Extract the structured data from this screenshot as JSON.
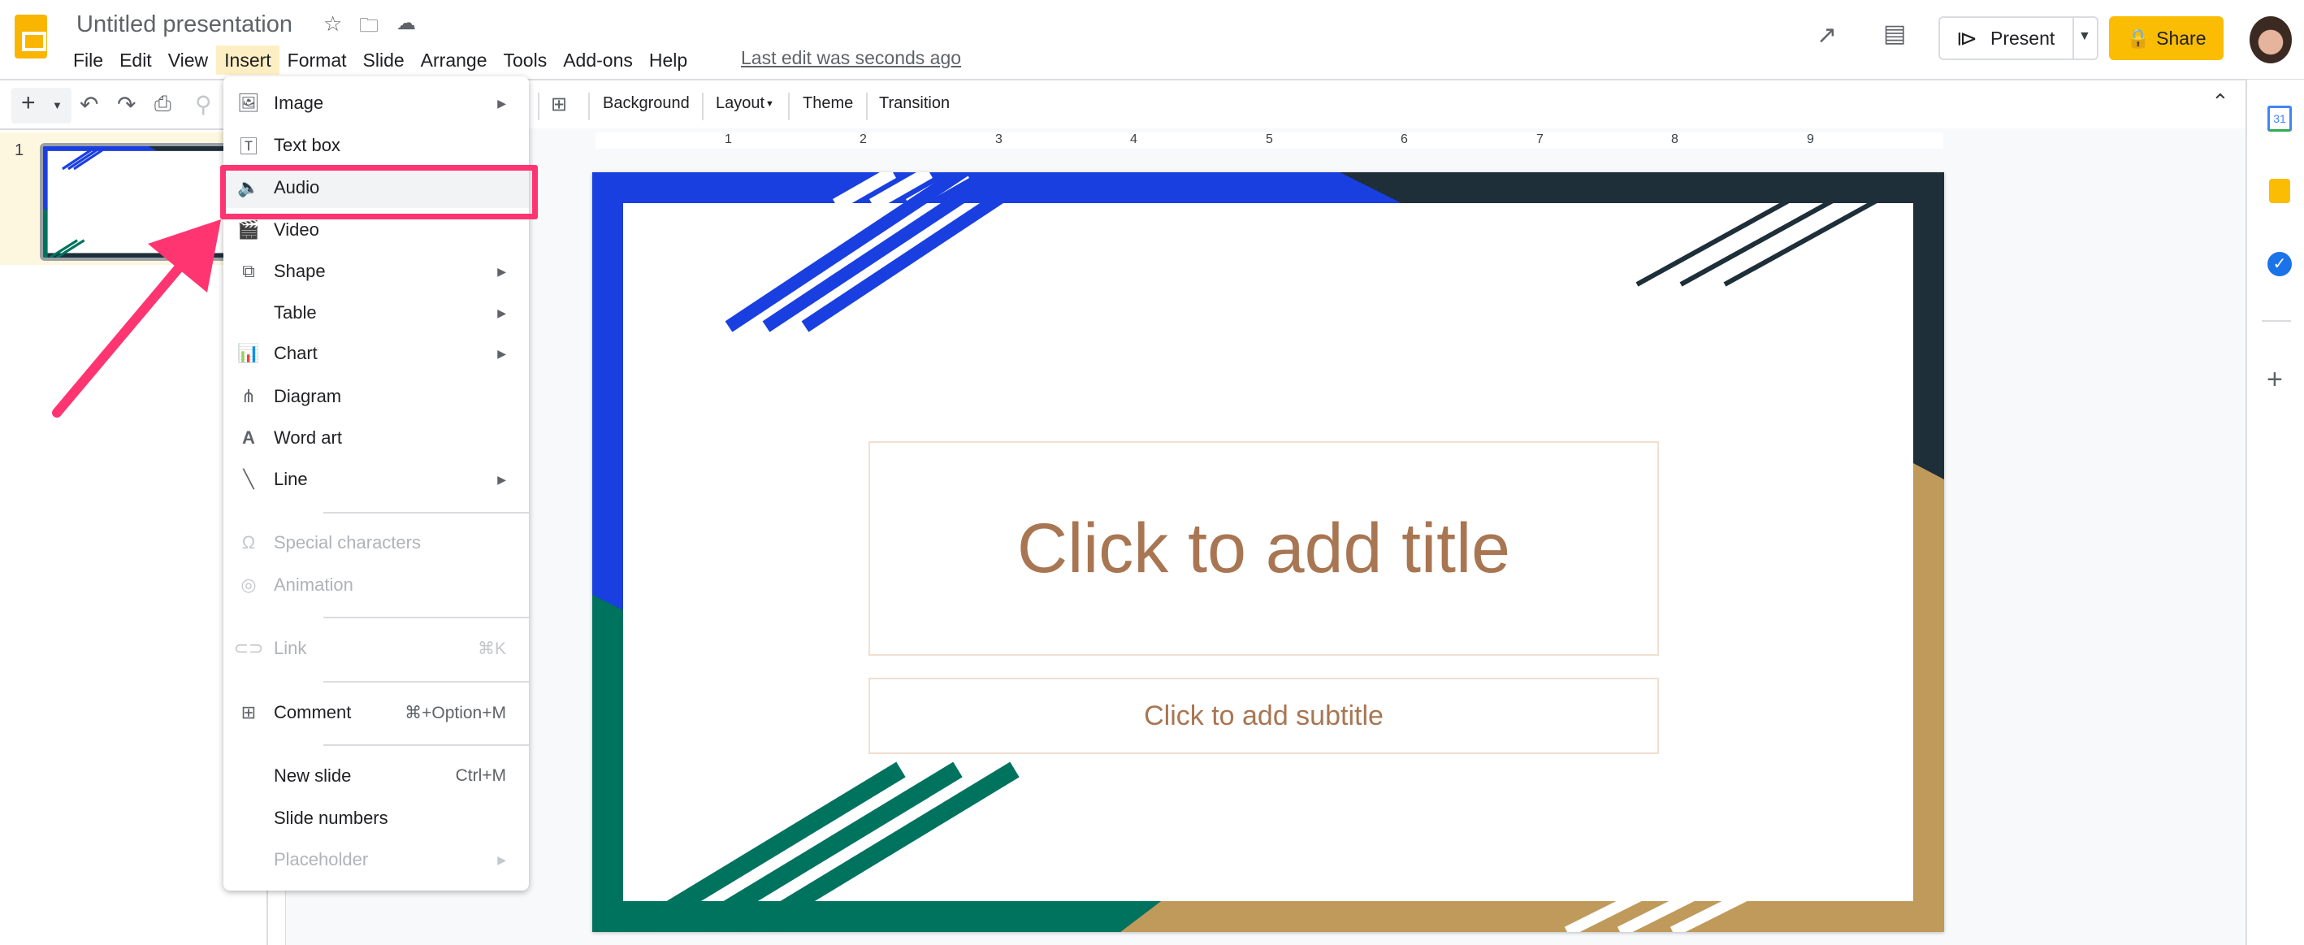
{
  "header": {
    "title": "Untitled presentation",
    "last_edit": "Last edit was seconds ago",
    "present_label": "Present",
    "share_label": "Share",
    "menus": [
      "File",
      "Edit",
      "View",
      "Insert",
      "Format",
      "Slide",
      "Arrange",
      "Tools",
      "Add-ons",
      "Help"
    ],
    "active_menu": "Insert"
  },
  "toolbar": {
    "background": "Background",
    "layout": "Layout",
    "theme": "Theme",
    "transition": "Transition"
  },
  "ruler": [
    "1",
    "2",
    "3",
    "4",
    "5",
    "6",
    "7",
    "8",
    "9"
  ],
  "filmstrip": {
    "slide_number": "1"
  },
  "slide": {
    "title_placeholder": "Click to add title",
    "subtitle_placeholder": "Click to add subtitle"
  },
  "insert_menu": {
    "items": [
      {
        "label": "Image",
        "icon": "image-icon",
        "submenu": true
      },
      {
        "label": "Text box",
        "icon": "text-box-icon"
      },
      {
        "label": "Audio",
        "icon": "audio-icon",
        "highlighted": true
      },
      {
        "label": "Video",
        "icon": "video-icon"
      },
      {
        "label": "Shape",
        "icon": "shape-icon",
        "submenu": true
      },
      {
        "label": "Table",
        "submenu": true
      },
      {
        "label": "Chart",
        "icon": "chart-icon",
        "submenu": true
      },
      {
        "label": "Diagram",
        "icon": "diagram-icon"
      },
      {
        "label": "Word art",
        "icon": "word-art-icon"
      },
      {
        "label": "Line",
        "icon": "line-icon",
        "submenu": true
      },
      {
        "label": "Special characters",
        "icon": "omega-icon",
        "disabled": true
      },
      {
        "label": "Animation",
        "icon": "animation-icon",
        "disabled": true
      },
      {
        "label": "Link",
        "icon": "link-icon",
        "disabled": true,
        "shortcut": "⌘K"
      },
      {
        "label": "Comment",
        "icon": "comment-icon",
        "shortcut": "⌘+Option+M"
      },
      {
        "label": "New slide",
        "shortcut": "Ctrl+M"
      },
      {
        "label": "Slide numbers"
      },
      {
        "label": "Placeholder",
        "disabled": true,
        "submenu": true
      }
    ]
  },
  "sidebar": {
    "calendar_day": "31"
  },
  "colors": {
    "accent_share": "#fbbc04",
    "highlight_box": "#ff3572",
    "slide_blue": "#1a3fe0",
    "slide_dark": "#1e2f3a",
    "slide_tan": "#bf9a5a",
    "slide_green": "#00735f",
    "placeholder_text": "#a87652"
  }
}
